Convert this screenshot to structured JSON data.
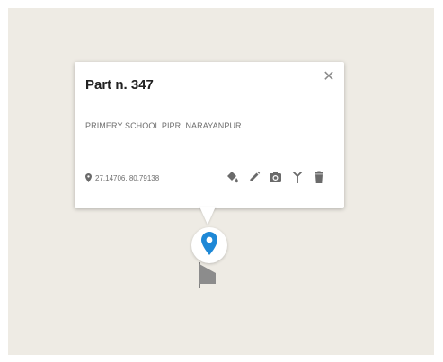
{
  "popup": {
    "title": "Part n. 347",
    "description": "PRIMERY SCHOOL PIPRI NARAYANPUR",
    "coordinates": "27.14706, 80.79138",
    "close_icon": "close-icon",
    "actions": [
      {
        "icon": "paint-bucket-icon"
      },
      {
        "icon": "pencil-icon"
      },
      {
        "icon": "camera-icon"
      },
      {
        "icon": "antenna-icon"
      },
      {
        "icon": "trash-icon"
      }
    ]
  },
  "marker": {
    "icon": "map-pin-icon",
    "color": "#1e88d6"
  },
  "colors": {
    "map_background": "#eeebe4",
    "icon_gray": "#6a6a6a"
  }
}
